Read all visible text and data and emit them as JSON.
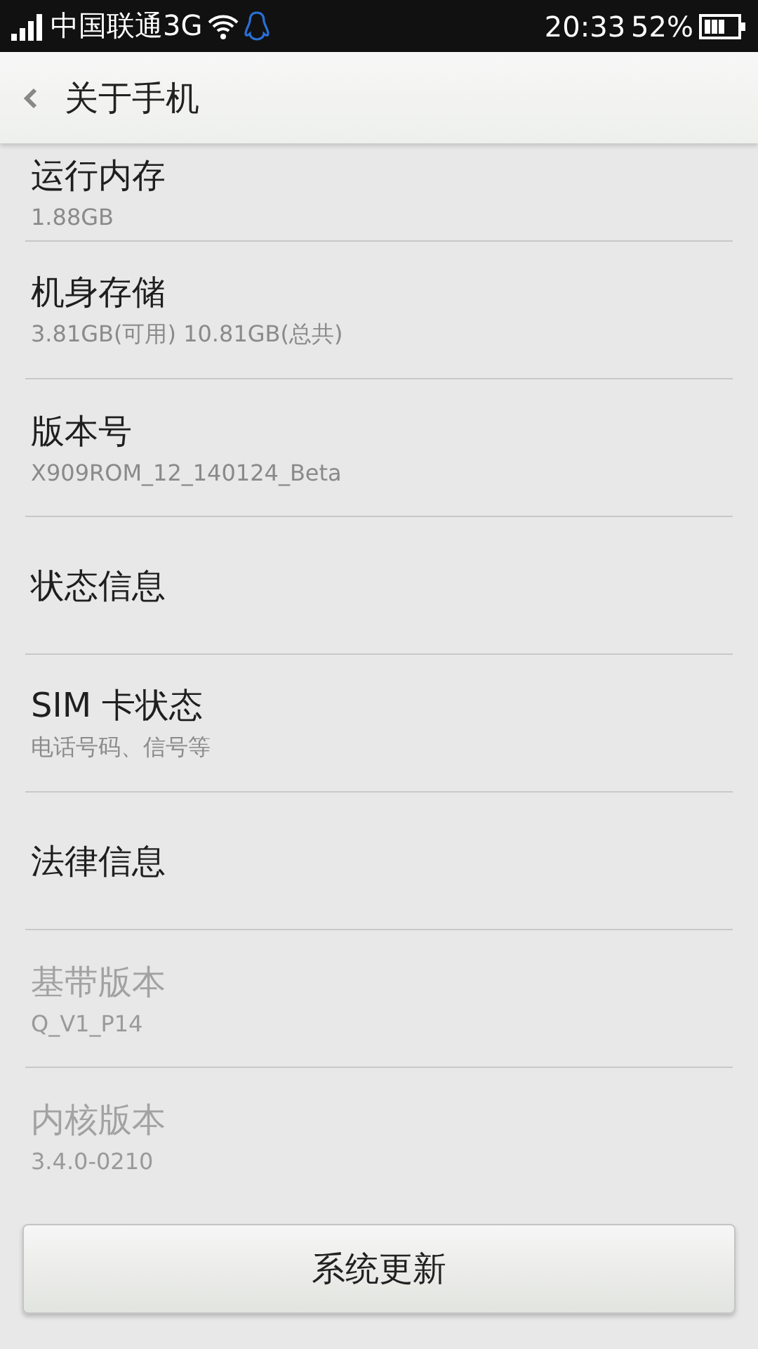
{
  "status_bar": {
    "carrier": "中国联通3G",
    "time": "20:33",
    "battery": "52%"
  },
  "header": {
    "title": "关于手机"
  },
  "items": [
    {
      "title": "运行内存",
      "subtitle": "1.88GB",
      "disabled": false
    },
    {
      "title": "机身存储",
      "subtitle": "3.81GB(可用)  10.81GB(总共)",
      "disabled": false
    },
    {
      "title": "版本号",
      "subtitle": "X909ROM_12_140124_Beta",
      "disabled": false
    },
    {
      "title": "状态信息",
      "disabled": false
    },
    {
      "title": "SIM 卡状态",
      "subtitle": "电话号码、信号等",
      "disabled": false
    },
    {
      "title": "法律信息",
      "disabled": false
    },
    {
      "title": "基带版本",
      "subtitle": "Q_V1_P14",
      "disabled": true
    },
    {
      "title": "内核版本",
      "subtitle": "3.4.0-0210",
      "disabled": true
    }
  ],
  "button": "系统更新"
}
